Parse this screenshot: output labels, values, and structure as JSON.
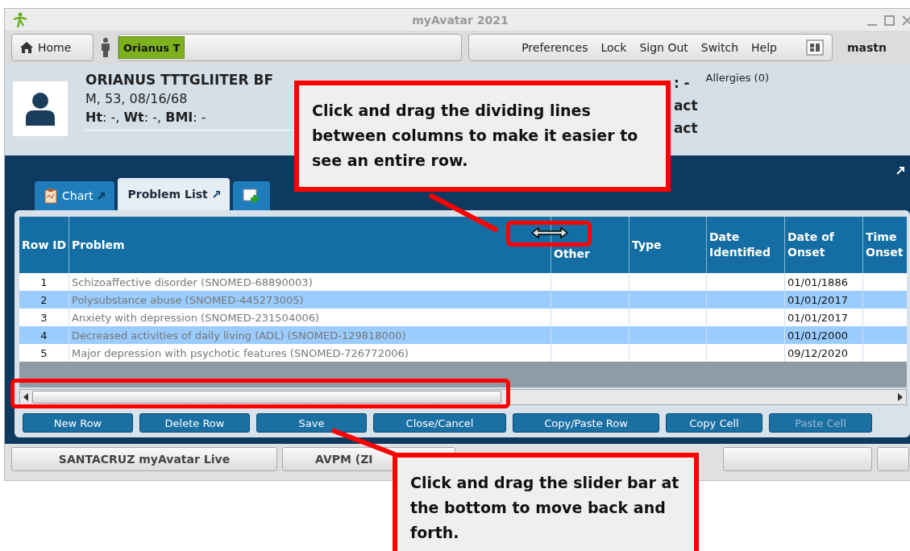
{
  "window": {
    "title": "myAvatar 2021"
  },
  "toolbar": {
    "home": "Home",
    "patient": "Orianus T",
    "menu": [
      "Preferences",
      "Lock",
      "Sign Out",
      "Switch",
      "Help"
    ],
    "user": "mastn"
  },
  "patient": {
    "name": "ORIANUS TTTGLIITER BF",
    "demographics": "M, 53, 08/16/68",
    "measurements": "**Ht**: -, **Wt**: -, **BMI**: -",
    "field_1": ": -",
    "allergies": "Allergies (0)",
    "field_2": "act",
    "field_3": "act"
  },
  "tabs": [
    {
      "label": "Chart",
      "selected": false
    },
    {
      "label": "Problem List",
      "selected": true
    }
  ],
  "table": {
    "columns": [
      "Row ID",
      "Problem",
      "Other",
      "Type",
      "Date Identified",
      "Date of Onset",
      "Time Onset"
    ],
    "rows": [
      {
        "row_id": "1",
        "problem": "Schizoaffective disorder (SNOMED-68890003)",
        "date_of_onset": "01/01/1886"
      },
      {
        "row_id": "2",
        "problem": "Polysubstance abuse (SNOMED-445273005)",
        "date_of_onset": "01/01/2017"
      },
      {
        "row_id": "3",
        "problem": "Anxiety with depression (SNOMED-231504006)",
        "date_of_onset": "01/01/2017"
      },
      {
        "row_id": "4",
        "problem": "Decreased activities of daily living (ADL) (SNOMED-129818000)",
        "date_of_onset": "01/01/2000"
      },
      {
        "row_id": "5",
        "problem": "Major depression with psychotic features (SNOMED-726772006)",
        "date_of_onset": "09/12/2020"
      }
    ]
  },
  "buttons": [
    {
      "label": "New Row",
      "disabled": false
    },
    {
      "label": "Delete Row",
      "disabled": false
    },
    {
      "label": "Save",
      "disabled": false
    },
    {
      "label": "Close/Cancel",
      "disabled": false
    },
    {
      "label": "Copy/Paste Row",
      "disabled": false
    },
    {
      "label": "Copy Cell",
      "disabled": false
    },
    {
      "label": "Paste Cell",
      "disabled": true
    }
  ],
  "status_bar": [
    "SANTACRUZ myAvatar Live",
    "AVPM (ZI"
  ],
  "callouts": [
    "Click and drag the dividing lines between columns to make it easier to see an entire row.",
    "Click and drag the slider bar at the bottom to move back and forth."
  ]
}
